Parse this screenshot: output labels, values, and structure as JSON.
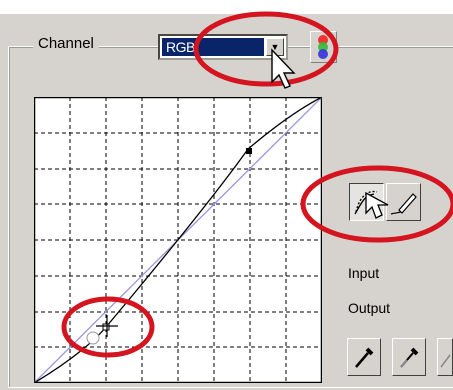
{
  "channel": {
    "label": "Channel",
    "selected": "RGB"
  },
  "labels": {
    "input": "Input",
    "output": "Output"
  },
  "icons": {
    "dropdown": "chevron-down-icon",
    "rgb": "rgb-channels-icon",
    "curve_tool": "curve-tool-icon",
    "pencil_tool": "pencil-tool-icon",
    "black_eyedropper": "eyedropper-icon",
    "gray_eyedropper": "eyedropper-icon",
    "white_eyedropper": "eyedropper-icon"
  },
  "colors": {
    "highlight_circle": "#d4141e",
    "selection": "#0a246a",
    "panel": "#d6d3ce",
    "diagonal": "#9a96e0"
  }
}
